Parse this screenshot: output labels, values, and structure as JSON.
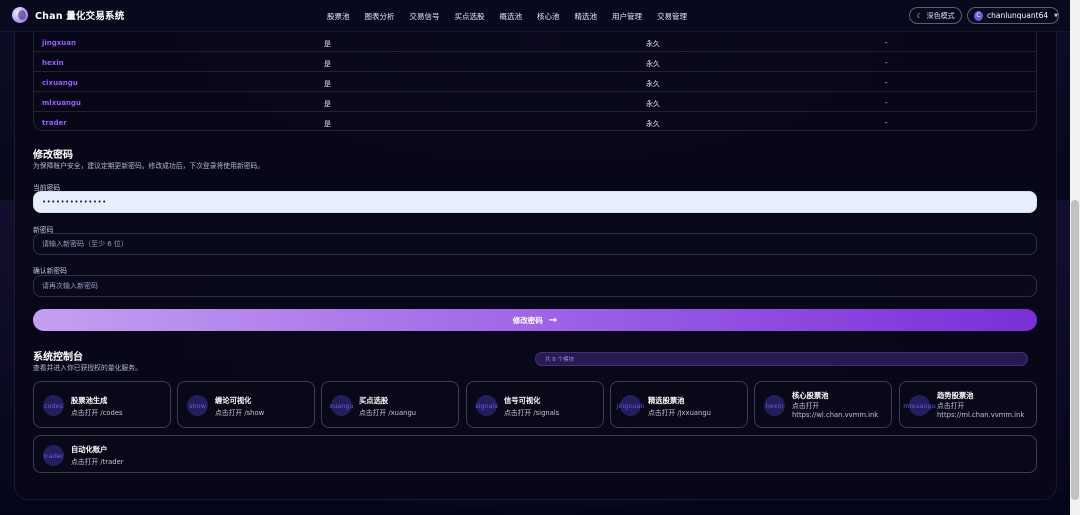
{
  "brand": {
    "name": "Chan 量化交易系统"
  },
  "nav": [
    "股票池",
    "图表分析",
    "交易信号",
    "买点选股",
    "概选池",
    "核心池",
    "精选池",
    "用户管理",
    "交易管理"
  ],
  "theme": {
    "label": "深色模式",
    "icon": "moon-icon"
  },
  "user": {
    "name": "chanlunquant64",
    "initial": "C"
  },
  "permissions": [
    {
      "name": "jingxuan",
      "enabled": "是",
      "expiry": "永久",
      "note": "-"
    },
    {
      "name": "hexin",
      "enabled": "是",
      "expiry": "永久",
      "note": "-"
    },
    {
      "name": "cixuangu",
      "enabled": "是",
      "expiry": "永久",
      "note": "-"
    },
    {
      "name": "mlxuangu",
      "enabled": "是",
      "expiry": "永久",
      "note": "-"
    },
    {
      "name": "trader",
      "enabled": "是",
      "expiry": "永久",
      "note": "-"
    }
  ],
  "password": {
    "title": "修改密码",
    "subtitle": "为保障账户安全，建议定期更新密码。修改成功后，下次登录将使用新密码。",
    "current_label": "当前密码",
    "current_value": "••••••••••••••",
    "new_label": "新密码",
    "new_placeholder": "请输入新密码（至少 6 位）",
    "confirm_label": "确认新密码",
    "confirm_placeholder": "请再次输入新密码",
    "submit_label": "修改密码",
    "submit_arrow": "→"
  },
  "console": {
    "title": "系统控制台",
    "subtitle": "查看并进入你已获授权的量化服务。",
    "count_text": "共 8 个模块",
    "services": [
      {
        "icon": "codes",
        "title": "股票池生成",
        "link": "点击打开 /codes"
      },
      {
        "icon": "show",
        "title": "缠论可视化",
        "link": "点击打开 /show"
      },
      {
        "icon": "xuangu",
        "title": "买点选股",
        "link": "点击打开 /xuangu"
      },
      {
        "icon": "signals",
        "title": "信号可视化",
        "link": "点击打开 /signals"
      },
      {
        "icon": "jingxuan",
        "title": "精选股票池",
        "link": "点击打开 /jxxuangu"
      },
      {
        "icon": "hexin",
        "title": "核心股票池",
        "link": "点击打开",
        "link2": "https://wl.chan.vvmm.ink"
      },
      {
        "icon": "mlxuangu",
        "title": "趋势股票池",
        "link": "点击打开",
        "link2": "https://ml.chan.vvmm.ink"
      },
      {
        "icon": "trader",
        "title": "自动化账户",
        "link": "点击打开 /trader"
      }
    ]
  }
}
